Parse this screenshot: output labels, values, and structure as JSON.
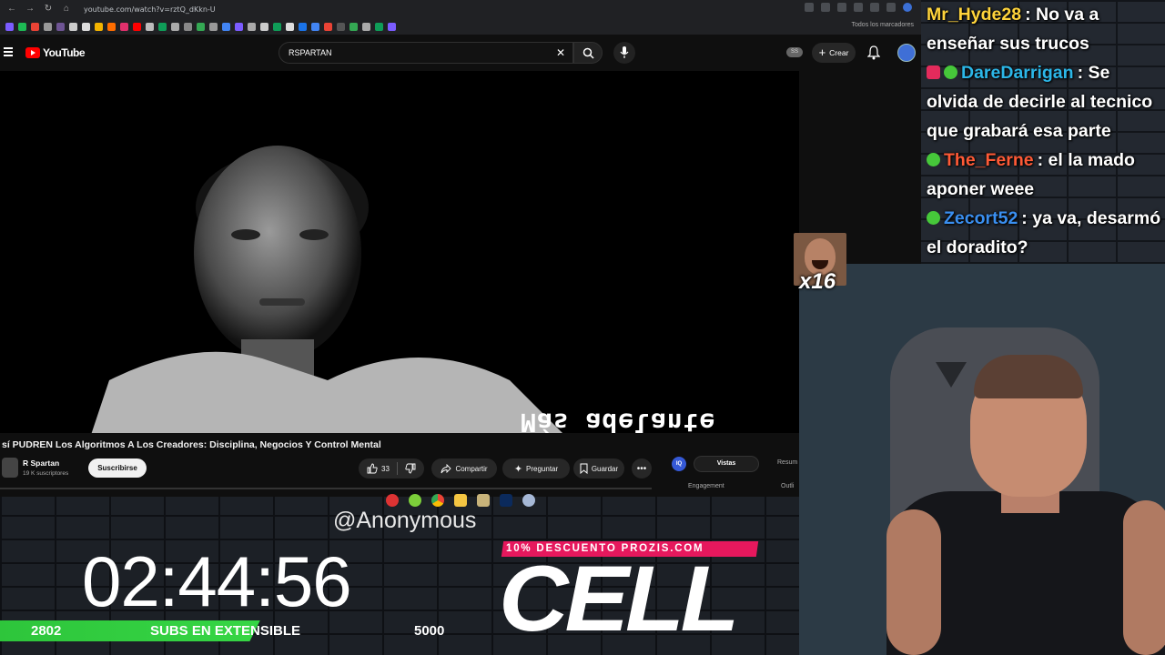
{
  "browser": {
    "url": "youtube.com/watch?v=rztQ_dKkn-U",
    "bookmarks_folder": "Todos los marcadores"
  },
  "youtube": {
    "logo_text": "YouTube",
    "search_value": "RSPARTAN",
    "create_label": "Crear",
    "badge_text": "SS"
  },
  "video": {
    "overlay_caption": "Más adelante",
    "title": "sí PUDREN Los Algoritmos A Los Creadores: Disciplina, Negocios Y Control Mental",
    "channel_name": "R Spartan",
    "channel_subs": "19 K suscriptores",
    "subscribe_label": "Suscribirse",
    "like_count": "33",
    "share_label": "Compartir",
    "ask_label": "Preguntar",
    "save_label": "Guardar"
  },
  "side_panel": {
    "logo": "IQ",
    "tab_active": "Vistas",
    "tab_other": "Resum",
    "label_left": "Engagement",
    "label_right": "Outli"
  },
  "stream": {
    "last_donor": "@Anonymous",
    "timer": "02:44:56",
    "subs_count": "2802",
    "subs_label": "SUBS EN EXTENSIBLE",
    "subs_goal": "5000",
    "subs_progress": 0.5604,
    "promo": "10% DESCUENTO PROZIS.COM",
    "sponsor": "CELL",
    "emote_count": "x16"
  },
  "chat": [
    {
      "user": "Mr_Hyde28",
      "color": "#ffd43b",
      "badges": [],
      "message": "No va a enseñar sus trucos"
    },
    {
      "user": "DareDarrigan",
      "color": "#2cb7e8",
      "badges": [
        "red",
        "green"
      ],
      "message": "Se olvida de decirle al tecnico que grabará esa parte"
    },
    {
      "user": "The_Ferne",
      "color": "#ff5a36",
      "badges": [
        "green"
      ],
      "message": "el la mado aponer weee"
    },
    {
      "user": "Zecort52",
      "color": "#3a8ff0",
      "badges": [
        "green"
      ],
      "message": "ya va, desarmó el doradito?"
    }
  ],
  "colors": {
    "youtube_red": "#ff0000",
    "progress_green": "#36d645",
    "promo_pink": "#e6185d"
  }
}
